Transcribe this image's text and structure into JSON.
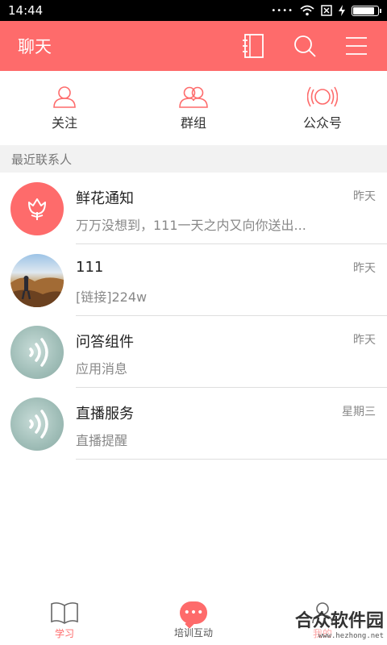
{
  "status_bar": {
    "time": "14:44",
    "signal_icon": "signal-dots-icon",
    "wifi_icon": "wifi-icon",
    "battery_icon": "battery-icon"
  },
  "header": {
    "title": "聊天",
    "icons": [
      "contacts-book-icon",
      "search-icon",
      "menu-icon"
    ]
  },
  "tabs": [
    {
      "label": "关注",
      "icon": "person-icon"
    },
    {
      "label": "群组",
      "icon": "group-icon"
    },
    {
      "label": "公众号",
      "icon": "broadcast-icon"
    }
  ],
  "section": {
    "title": "最近联系人"
  },
  "conversations": [
    {
      "name": "鲜花通知",
      "preview": "万万没想到，111一天之内又向你送出...",
      "time": "昨天",
      "avatar": "flower-icon"
    },
    {
      "name": "111",
      "preview": "[链接]224w",
      "time": "昨天",
      "avatar": "photo"
    },
    {
      "name": "问答组件",
      "preview": "应用消息",
      "time": "昨天",
      "avatar": "radio-wave-icon"
    },
    {
      "name": "直播服务",
      "preview": "直播提醒",
      "time": "星期三",
      "avatar": "radio-wave-icon"
    }
  ],
  "bottom_nav": [
    {
      "label": "学习",
      "icon": "book-icon",
      "active": true
    },
    {
      "label": "培训互动",
      "icon": "chat-bubble-icon",
      "active": false
    },
    {
      "label": "我的",
      "icon": "profile-icon",
      "active": false
    }
  ],
  "watermark": {
    "main": "合众软件园",
    "sub": "www.hezhong.net"
  },
  "colors": {
    "accent": "#fe6b6b",
    "section_bg": "#f2f2f2"
  }
}
